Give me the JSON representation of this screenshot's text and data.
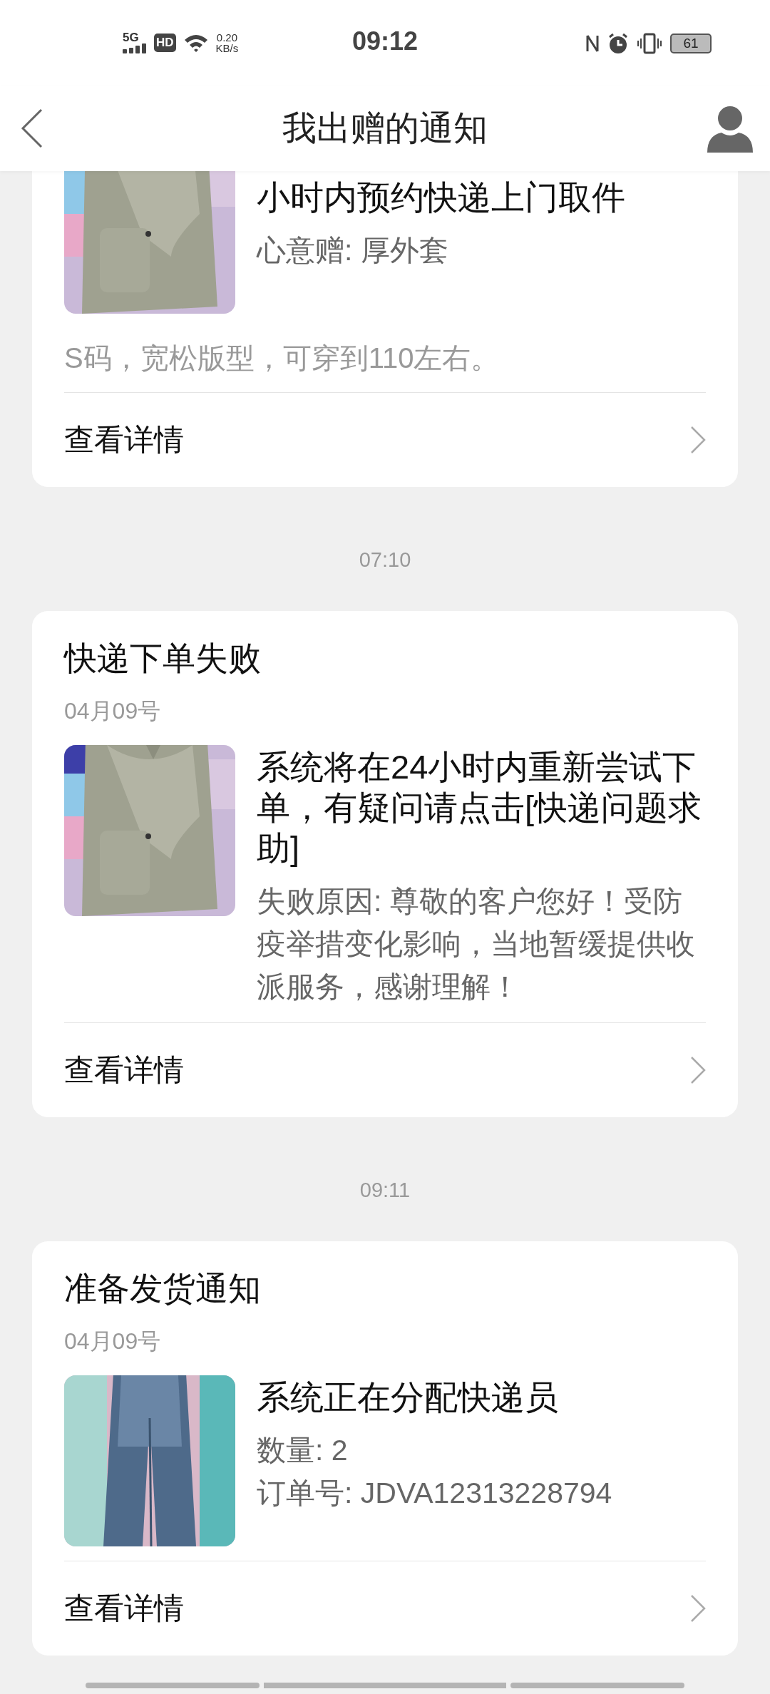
{
  "status_bar": {
    "network": "5G",
    "hd": "HD",
    "speed_value": "0.20",
    "speed_unit": "KB/s",
    "time": "09:12",
    "battery": "61"
  },
  "header": {
    "title": "我出赠的通知"
  },
  "feed": [
    {
      "kind": "card",
      "cut": true,
      "image": {
        "kind": "picture"
      },
      "message": "小时内预约快递上门取件",
      "details": [
        "心意赠: 厚外套"
      ],
      "note": "S码，宽松版型，可穿到110左右。",
      "action": "查看详情"
    },
    {
      "kind": "time",
      "text": "07:10"
    },
    {
      "kind": "card",
      "cut": false,
      "title": "快递下单失败",
      "date": "04月09号",
      "image": {
        "kind": "picture"
      },
      "message": "系统将在24小时内重新尝试下单，有疑问请点击[快递问题求助]",
      "details": [
        "失败原因: 尊敬的客户您好！受防疫举措变化影响，当地暂缓提供收派服务，感谢理解！"
      ],
      "action": "查看详情"
    },
    {
      "kind": "time",
      "text": "09:11"
    },
    {
      "kind": "card",
      "cut": false,
      "title": "准备发货通知",
      "date": "04月09号",
      "image": {
        "kind": "picture"
      },
      "message": "系统正在分配快递员",
      "details": [
        "数量: 2",
        "订单号: JDVA12313228794"
      ],
      "action": "查看详情"
    }
  ]
}
